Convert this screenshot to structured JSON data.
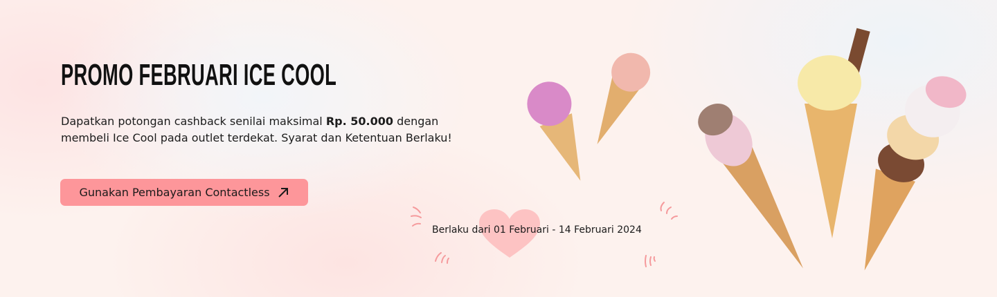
{
  "banner": {
    "title": "PROMO FEBRUARI ICE COOL",
    "description_before": "Dapatkan potongan cashback senilai maksimal ",
    "description_bold": "Rp. 50.000",
    "description_after": " dengan membeli Ice Cool pada outlet terdekat. Syarat dan Ketentuan Berlaku!",
    "cta_label": "Gunakan Pembayaran Contactless",
    "cta_icon": "arrow-up-right-icon",
    "validity": "Berlaku dari 01 Februari - 14 Februari 2024"
  },
  "colors": {
    "accent": "#fd969a",
    "heart": "#fdc3c3",
    "spark": "#f59a9c"
  }
}
